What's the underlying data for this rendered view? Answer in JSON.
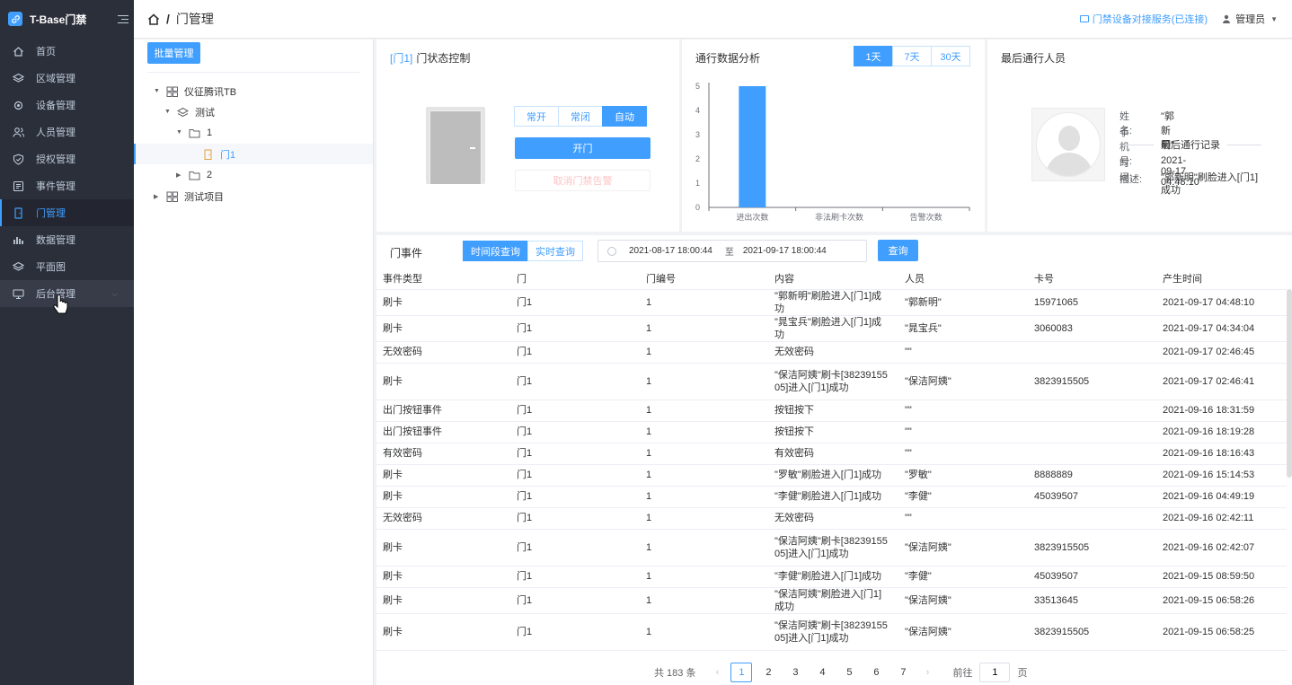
{
  "app": {
    "title": "T-Base门禁"
  },
  "sidebar": {
    "items": [
      {
        "label": "首页",
        "icon": "home-icon"
      },
      {
        "label": "区域管理",
        "icon": "layers-icon"
      },
      {
        "label": "设备管理",
        "icon": "chip-icon"
      },
      {
        "label": "人员管理",
        "icon": "users-icon"
      },
      {
        "label": "授权管理",
        "icon": "shield-icon"
      },
      {
        "label": "事件管理",
        "icon": "list-icon"
      },
      {
        "label": "门管理",
        "icon": "door-icon",
        "active": true
      },
      {
        "label": "数据管理",
        "icon": "bar-chart-icon"
      },
      {
        "label": "平面图",
        "icon": "layers-icon"
      },
      {
        "label": "后台管理",
        "icon": "monitor-icon"
      }
    ]
  },
  "header": {
    "breadcrumb": "门管理",
    "service_status": "门禁设备对接服务(已连接)",
    "user": "管理员"
  },
  "tree": {
    "batch_label": "批量管理",
    "nodes": [
      {
        "label": "仪征腾讯TB"
      },
      {
        "label": "测试"
      },
      {
        "label": "1"
      },
      {
        "label": "门1"
      },
      {
        "label": "2"
      },
      {
        "label": "测试项目"
      }
    ]
  },
  "door_control": {
    "door_tag": "[门1]",
    "title": "门状态控制",
    "modes": [
      "常开",
      "常闭",
      "自动"
    ],
    "active_mode": "自动",
    "open_label": "开门",
    "cancel_label": "取消门禁告警"
  },
  "traffic": {
    "title": "通行数据分析",
    "ranges": [
      "1天",
      "7天",
      "30天"
    ],
    "active_range": "1天"
  },
  "chart_data": {
    "type": "bar",
    "categories": [
      "进出次数",
      "非法刷卡次数",
      "告警次数"
    ],
    "values": [
      5,
      0,
      0
    ],
    "ylim": [
      0,
      5
    ],
    "yticks": [
      0,
      1,
      2,
      3,
      4,
      5
    ],
    "color": "#409eff"
  },
  "last_person": {
    "title": "最后通行人员",
    "name_label": "姓名:",
    "name": "\"郭新明\"",
    "phone_label": "手机号:",
    "phone": "",
    "record_title": "最后通行记录",
    "time_label": "时间:",
    "time": "2021-09-17 04:48:10",
    "desc_label": "描述:",
    "desc": "\"郭新明\"刷脸进入[门1]成功"
  },
  "events": {
    "title": "门事件",
    "query_modes": [
      "时间段查询",
      "实时查询"
    ],
    "active_query": "时间段查询",
    "start": "2021-08-17 18:00:44",
    "range_sep": "至",
    "end": "2021-09-17 18:00:44",
    "query_label": "查询",
    "columns": [
      "事件类型",
      "门",
      "门编号",
      "内容",
      "人员",
      "卡号",
      "产生时间"
    ],
    "rows": [
      [
        "刷卡",
        "门1",
        "1",
        "\"郭新明\"刷脸进入[门1]成功",
        "\"郭新明\"",
        "15971065",
        "2021-09-17 04:48:10"
      ],
      [
        "刷卡",
        "门1",
        "1",
        "\"晁宝兵\"刷脸进入[门1]成功",
        "\"晁宝兵\"",
        "3060083",
        "2021-09-17 04:34:04"
      ],
      [
        "无效密码",
        "门1",
        "1",
        "无效密码",
        "\"\"",
        "",
        "2021-09-17 02:46:45"
      ],
      [
        "刷卡",
        "门1",
        "1",
        "\"保洁阿姨\"刷卡[3823915505]进入[门1]成功",
        "\"保洁阿姨\"",
        "3823915505",
        "2021-09-17 02:46:41"
      ],
      [
        "出门按钮事件",
        "门1",
        "1",
        "按钮按下",
        "\"\"",
        "",
        "2021-09-16 18:31:59"
      ],
      [
        "出门按钮事件",
        "门1",
        "1",
        "按钮按下",
        "\"\"",
        "",
        "2021-09-16 18:19:28"
      ],
      [
        "有效密码",
        "门1",
        "1",
        "有效密码",
        "\"\"",
        "",
        "2021-09-16 18:16:43"
      ],
      [
        "刷卡",
        "门1",
        "1",
        "\"罗敏\"刷脸进入[门1]成功",
        "\"罗敏\"",
        "8888889",
        "2021-09-16 15:14:53"
      ],
      [
        "刷卡",
        "门1",
        "1",
        "\"李健\"刷脸进入[门1]成功",
        "\"李健\"",
        "45039507",
        "2021-09-16 04:49:19"
      ],
      [
        "无效密码",
        "门1",
        "1",
        "无效密码",
        "\"\"",
        "",
        "2021-09-16 02:42:11"
      ],
      [
        "刷卡",
        "门1",
        "1",
        "\"保洁阿姨\"刷卡[3823915505]进入[门1]成功",
        "\"保洁阿姨\"",
        "3823915505",
        "2021-09-16 02:42:07"
      ],
      [
        "刷卡",
        "门1",
        "1",
        "\"李健\"刷脸进入[门1]成功",
        "\"李健\"",
        "45039507",
        "2021-09-15 08:59:50"
      ],
      [
        "刷卡",
        "门1",
        "1",
        "\"保洁阿姨\"刷脸进入[门1]成功",
        "\"保洁阿姨\"",
        "33513645",
        "2021-09-15 06:58:26"
      ],
      [
        "刷卡",
        "门1",
        "1",
        "\"保洁阿姨\"刷卡[3823915505]进入[门1]成功",
        "\"保洁阿姨\"",
        "3823915505",
        "2021-09-15 06:58:25"
      ]
    ]
  },
  "pagination": {
    "total": "共 183 条",
    "pages": [
      "1",
      "2",
      "3",
      "4",
      "5",
      "6",
      "7"
    ],
    "current": "1",
    "goto_label": "前往",
    "goto_value": "1",
    "page_unit": "页"
  }
}
